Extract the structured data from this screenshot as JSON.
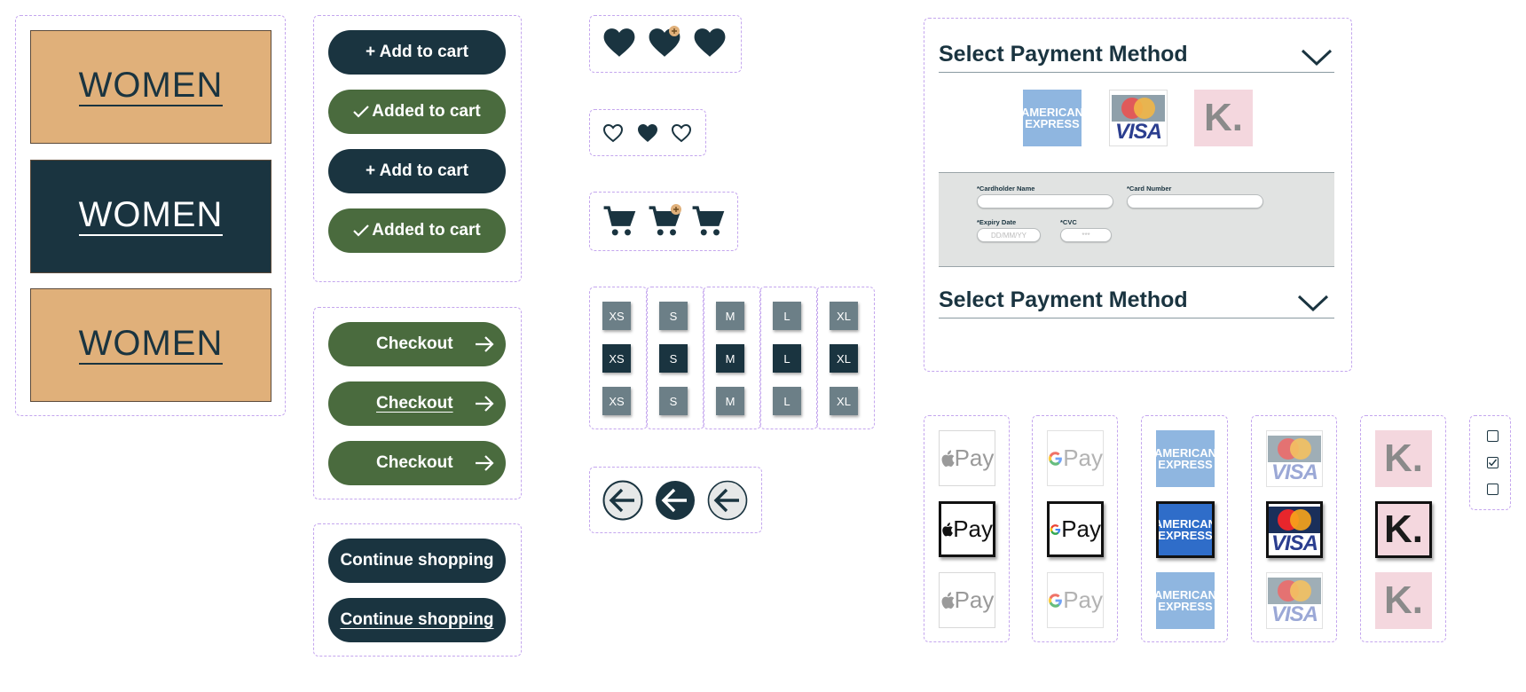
{
  "category": {
    "label": "WOMEN",
    "tiles": [
      {
        "bg": "#e0b07a",
        "fg": "#1a3440"
      },
      {
        "bg": "#1a3440",
        "fg": "#ffffff"
      },
      {
        "bg": "#e0b07a",
        "fg": "#1a3440"
      }
    ]
  },
  "cart_buttons": {
    "add": "+ Add to cart",
    "added": "Added to cart"
  },
  "checkout_buttons": {
    "label": "Checkout"
  },
  "continue_buttons": {
    "label": "Continue shopping"
  },
  "sizes": [
    "XS",
    "S",
    "M",
    "L",
    "XL"
  ],
  "payment": {
    "title": "Select Payment Method",
    "cardholder_label": "*Cardholder Name",
    "card_number_label": "*Card Number",
    "expiry_label": "*Expiry Date",
    "expiry_placeholder": "DD/MM/YY",
    "cvc_label": "*CVC",
    "cvc_placeholder": "***"
  },
  "logos": {
    "amex_line1": "AMERICAN",
    "amex_line2": "EXPRESS",
    "mastercard": "MasterCard",
    "visa": "VISA",
    "klarna": "K.",
    "pay": "Pay"
  },
  "colors": {
    "navy": "#1a3440",
    "green": "#4a6b3e",
    "tan": "#e0b07a",
    "dashed": "#c4a6ee",
    "badge": "#e0b07a"
  },
  "checkboxes": [
    false,
    true,
    false
  ]
}
